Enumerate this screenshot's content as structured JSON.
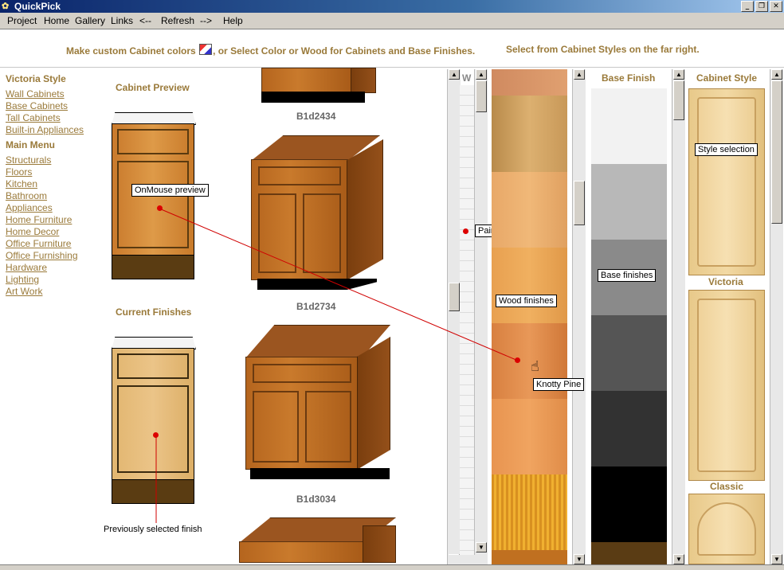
{
  "window": {
    "title": "QuickPick",
    "icon": "app-logo-icon",
    "controls": [
      "minimize",
      "restore",
      "close"
    ]
  },
  "menu": [
    "Project",
    "Home",
    "Gallery",
    "Links",
    "<--",
    "Refresh",
    "-->",
    "Help"
  ],
  "header": {
    "instruction_left_a": "Make custom Cabinet colors",
    "instruction_left_b": ", or Select Color or Wood for Cabinets and Base Finishes.",
    "instruction_right": "Select from Cabinet Styles on the far right."
  },
  "sidebar": {
    "style_heading": "Victoria Style",
    "style_links": [
      "Wall Cabinets",
      "Base Cabinets",
      "Tall Cabinets",
      "Built-in Appliances"
    ],
    "menu_heading": "Main Menu",
    "menu_links": [
      "Structurals",
      "Floors",
      "Kitchen",
      "Bathroom",
      "Appliances",
      "Home Furniture",
      "Home Decor",
      "Office Furniture",
      "Office Furnishing",
      "Hardware",
      "Lighting",
      "Art Work"
    ]
  },
  "preview": {
    "cabinet_preview_title": "Cabinet Preview",
    "current_finishes_title": "Current Finishes",
    "onmouse_callout": "OnMouse preview",
    "previous_callout": "Previously selected finish"
  },
  "cabinets": [
    {
      "code": "B1d2434"
    },
    {
      "code": "B1d2734"
    },
    {
      "code": "B1d3034"
    }
  ],
  "paint_column": {
    "label": "W",
    "callout": "Paint selection"
  },
  "wood_column": {
    "callout": "Wood finishes",
    "tooltip": "Knotty Pine"
  },
  "base_finish": {
    "title": "Base Finish",
    "callout": "Base finishes",
    "colors": [
      "#f2f2f2",
      "#b8b8b8",
      "#8a8a8a",
      "#555555",
      "#323232",
      "#000000",
      "#5a3c14",
      "#ffd480"
    ]
  },
  "cabinet_style": {
    "title": "Cabinet Style",
    "callout": "Style selection",
    "styles": [
      "Victoria",
      "Classic"
    ]
  },
  "colors": {
    "accent_text": "#9a7a3a",
    "callout_line": "#d00000"
  }
}
